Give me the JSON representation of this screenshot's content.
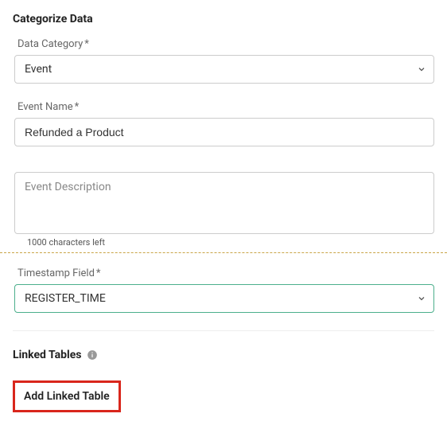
{
  "sectionTitle": "Categorize Data",
  "dataCategory": {
    "label": "Data Category",
    "required": "*",
    "value": "Event"
  },
  "eventName": {
    "label": "Event Name",
    "required": "*",
    "value": "Refunded a Product"
  },
  "eventDescription": {
    "placeholder": "Event Description",
    "helper": "1000 characters left"
  },
  "timestampField": {
    "label": "Timestamp Field",
    "required": "*",
    "value": "REGISTER_TIME"
  },
  "linkedTables": {
    "title": "Linked Tables",
    "addButton": "Add Linked Table"
  }
}
